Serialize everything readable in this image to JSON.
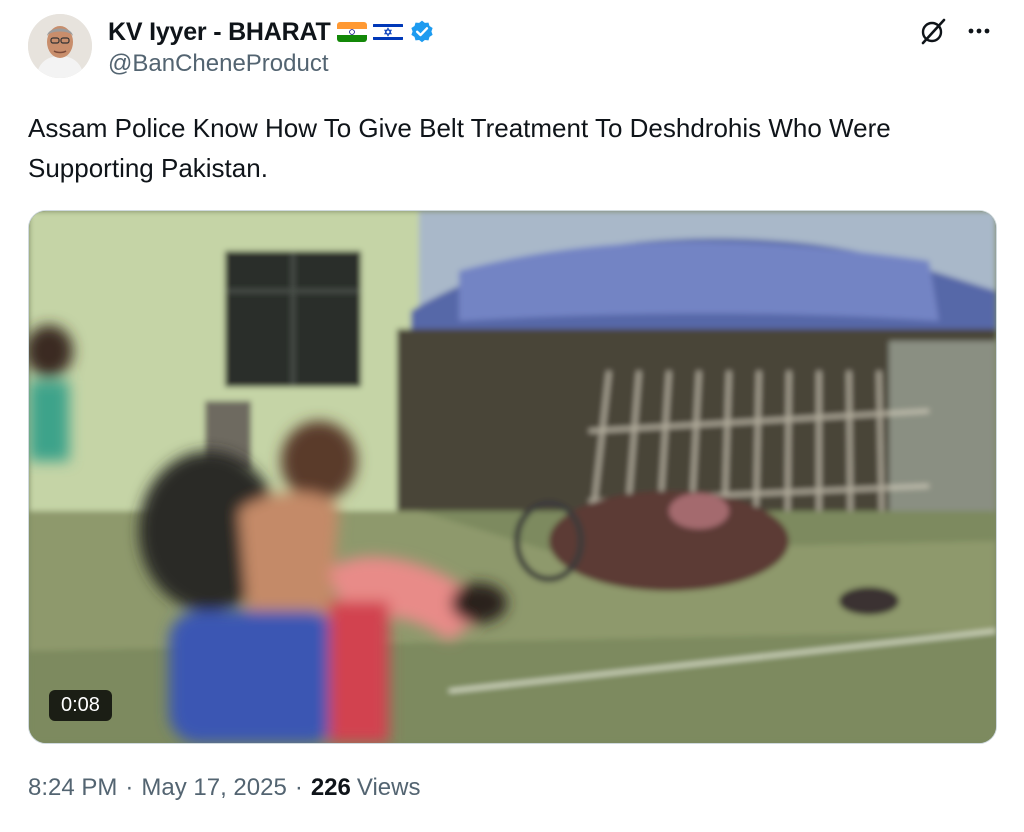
{
  "author": {
    "display_name": "KV Iyyer - BHARAT",
    "handle": "@BanCheneProduct",
    "flags": [
      "india-flag-icon",
      "israel-flag-icon"
    ],
    "verified": true
  },
  "tweet": {
    "text": "Assam Police Know How To Give Belt Treatment To Deshdrohis Who Were Supporting Pakistan."
  },
  "media": {
    "type": "video",
    "duration": "0:08"
  },
  "meta": {
    "time": "8:24 PM",
    "separator": "·",
    "date": "May 17, 2025",
    "views_count": "226",
    "views_label": "Views"
  },
  "icons": {
    "top_right": [
      "grok-icon",
      "more-icon"
    ]
  },
  "colors": {
    "text": "#0f1419",
    "secondary_text": "#536471",
    "verified_blue": "#1d9bf0",
    "border": "#cfd9de"
  }
}
